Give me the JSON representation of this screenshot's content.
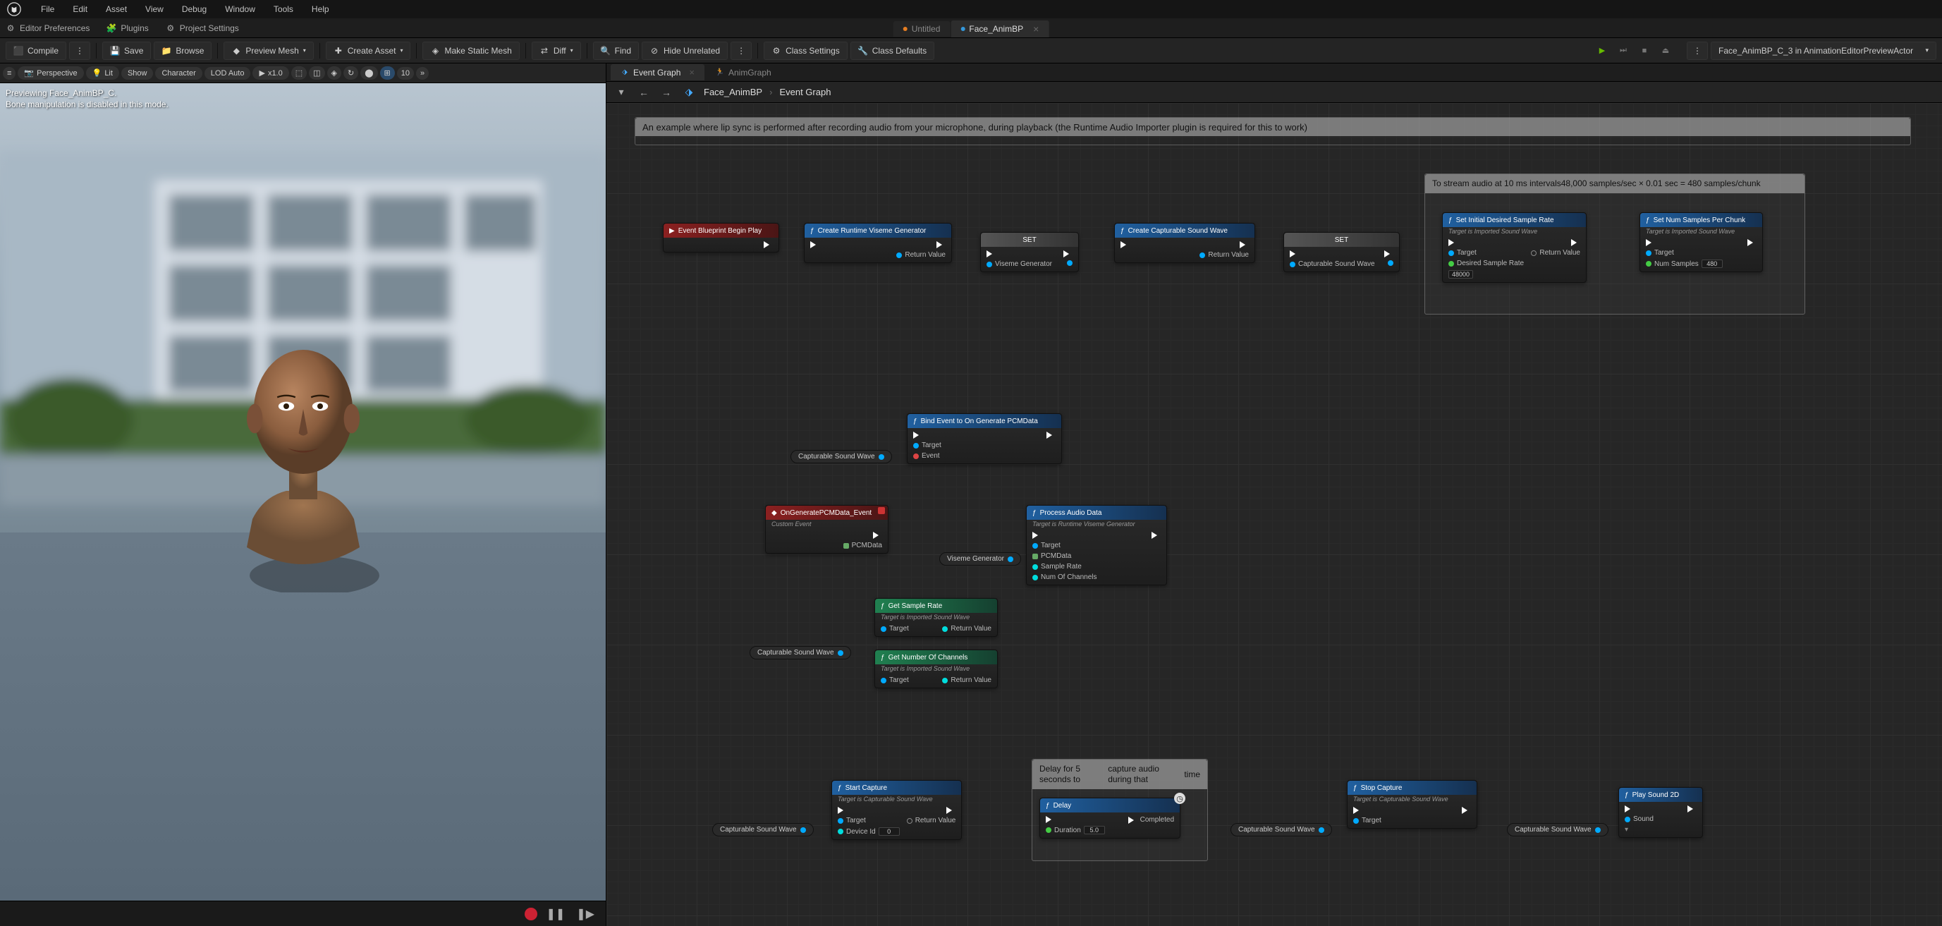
{
  "menu": {
    "items": [
      "File",
      "Edit",
      "Asset",
      "View",
      "Debug",
      "Window",
      "Tools",
      "Help"
    ]
  },
  "secondbar": {
    "editor_prefs": "Editor Preferences",
    "plugins": "Plugins",
    "project_settings": "Project Settings"
  },
  "title_tabs": {
    "untitled": "Untitled",
    "active": "Face_AnimBP"
  },
  "toolbar": {
    "compile": "Compile",
    "save": "Save",
    "browse": "Browse",
    "preview_mesh": "Preview Mesh",
    "create_asset": "Create Asset",
    "make_static": "Make Static Mesh",
    "diff": "Diff",
    "find": "Find",
    "hide_unrelated": "Hide Unrelated",
    "class_settings": "Class Settings",
    "class_defaults": "Class Defaults"
  },
  "debug_target": "Face_AnimBP_C_3 in AnimationEditorPreviewActor",
  "viewport": {
    "persp": "Perspective",
    "lit": "Lit",
    "show": "Show",
    "character": "Character",
    "lod": "LOD Auto",
    "speed": "x1.0",
    "grid": "10",
    "overlay_l1": "Previewing Face_AnimBP_C.",
    "overlay_l2": "Bone manipulation is disabled in this mode."
  },
  "graph_tabs": {
    "event": "Event Graph",
    "anim": "AnimGraph"
  },
  "breadcrumb": {
    "asset": "Face_AnimBP",
    "graph": "Event Graph"
  },
  "comments": {
    "main": "An example where lip sync is performed after recording audio from your microphone, during playback (the Runtime Audio Importer plugin is required for this to work)",
    "stream_l1": "To stream audio at 10 ms intervals",
    "stream_l2": "48,000 samples/sec × 0.01 sec = 480 samples/chunk",
    "delay_l1": "Delay for 5 seconds to",
    "delay_l2": "capture audio during that",
    "delay_l3": "time"
  },
  "nodes": {
    "begin_play": "Event Blueprint Begin Play",
    "create_viseme": "Create Runtime Viseme Generator",
    "set1": "SET",
    "set2": "SET",
    "create_wave": "Create Capturable Sound Wave",
    "set_sample": "Set Initial Desired Sample Rate",
    "set_samples": "Set Num Samples Per Chunk",
    "bind": "Bind Event to On Generate PCMData",
    "on_gen": "OnGeneratePCMData_Event",
    "on_gen_sub": "Custom Event",
    "process": "Process Audio Data",
    "process_sub": "Target is Runtime Viseme Generator",
    "get_rate": "Get Sample Rate",
    "get_rate_sub": "Target is Imported Sound Wave",
    "get_chan": "Get Number Of Channels",
    "get_chan_sub": "Target is Imported Sound Wave",
    "start_cap": "Start Capture",
    "start_cap_sub": "Target is Capturable Sound Wave",
    "stop_cap": "Stop Capture",
    "delay": "Delay",
    "playsound": "Play Sound 2D",
    "target_imported": "Target is Imported Sound Wave"
  },
  "pins": {
    "return_value": "Return Value",
    "viseme_gen": "Viseme Generator",
    "capturable": "Capturable Sound Wave",
    "target": "Target",
    "event": "Event",
    "pcmdata": "PCMData",
    "sample_rate": "Sample Rate",
    "channels": "Num Of Channels",
    "device_id": "Device Id",
    "device_id_v": "0",
    "duration": "Duration",
    "duration_v": "5.0",
    "completed": "Completed",
    "sound": "Sound",
    "desired_rate": "Desired Sample Rate",
    "rate_v": "48000",
    "num_samples": "Num Samples",
    "num_v": "480"
  },
  "var_nodes": {
    "capturable": "Capturable Sound Wave",
    "viseme": "Viseme Generator"
  }
}
